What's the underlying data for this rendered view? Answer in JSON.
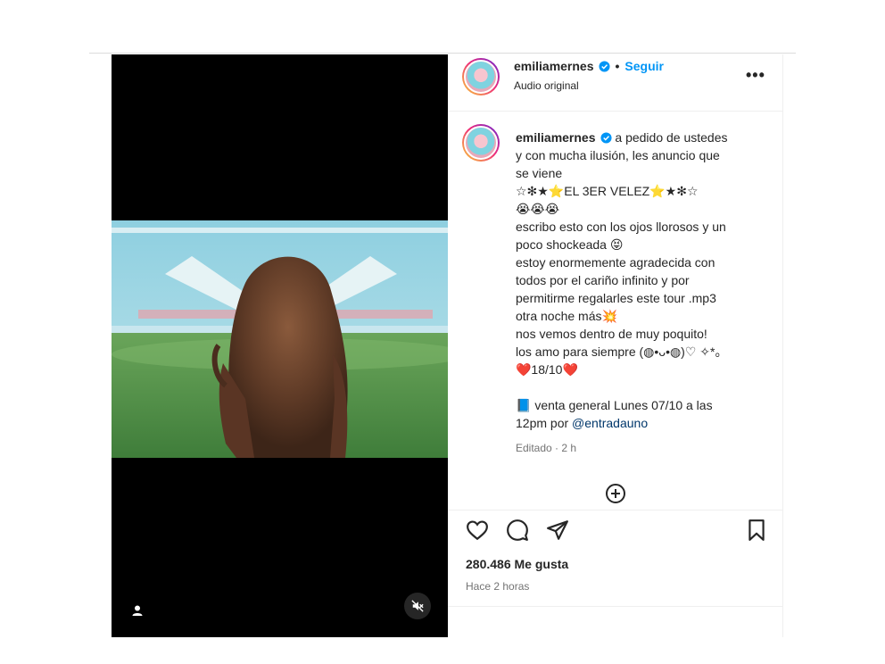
{
  "post": {
    "username": "emiliamernes",
    "follow_label": "Seguir",
    "separator": "•",
    "audio_label": "Audio original",
    "more_label": "•••"
  },
  "caption": {
    "username": "emiliamernes",
    "lines": [
      " a pedido de ustedes",
      "y con mucha ilusión, les anuncio que",
      "se viene",
      "☆✻★⭐EL 3ER VELEZ⭐★✻☆",
      "😭😭😭",
      "escribo esto con los ojos llorosos y un",
      "poco shockeada 😝",
      "estoy enormemente agradecida con",
      "todos por el cariño infinito y por",
      "permitirme regalarles este tour .mp3",
      "otra noche más💥",
      "nos vemos dentro de muy poquito!",
      "los amo para siempre (◍•ᴗ•◍)♡ ✧*。",
      "❤️18/10❤️",
      "",
      "📘 venta general Lunes 07/10 a las"
    ],
    "last_line_prefix": "12pm por ",
    "mention": "@entradauno",
    "edited_label": "Editado · 2 h"
  },
  "stats": {
    "likes": "280.486 Me gusta",
    "time": "Hace 2 horas"
  },
  "icons": {
    "like": "heart-icon",
    "comment": "comment-icon",
    "share": "paper-plane-icon",
    "save": "bookmark-icon",
    "add_comment": "plus-circle-icon",
    "mute": "muted-speaker-icon",
    "tag": "user-tag-icon",
    "verified": "verified-badge-icon"
  },
  "colors": {
    "accent": "#0095f6",
    "mention": "#00376b",
    "secondary_text": "#737373",
    "verified": "#0095f6"
  }
}
